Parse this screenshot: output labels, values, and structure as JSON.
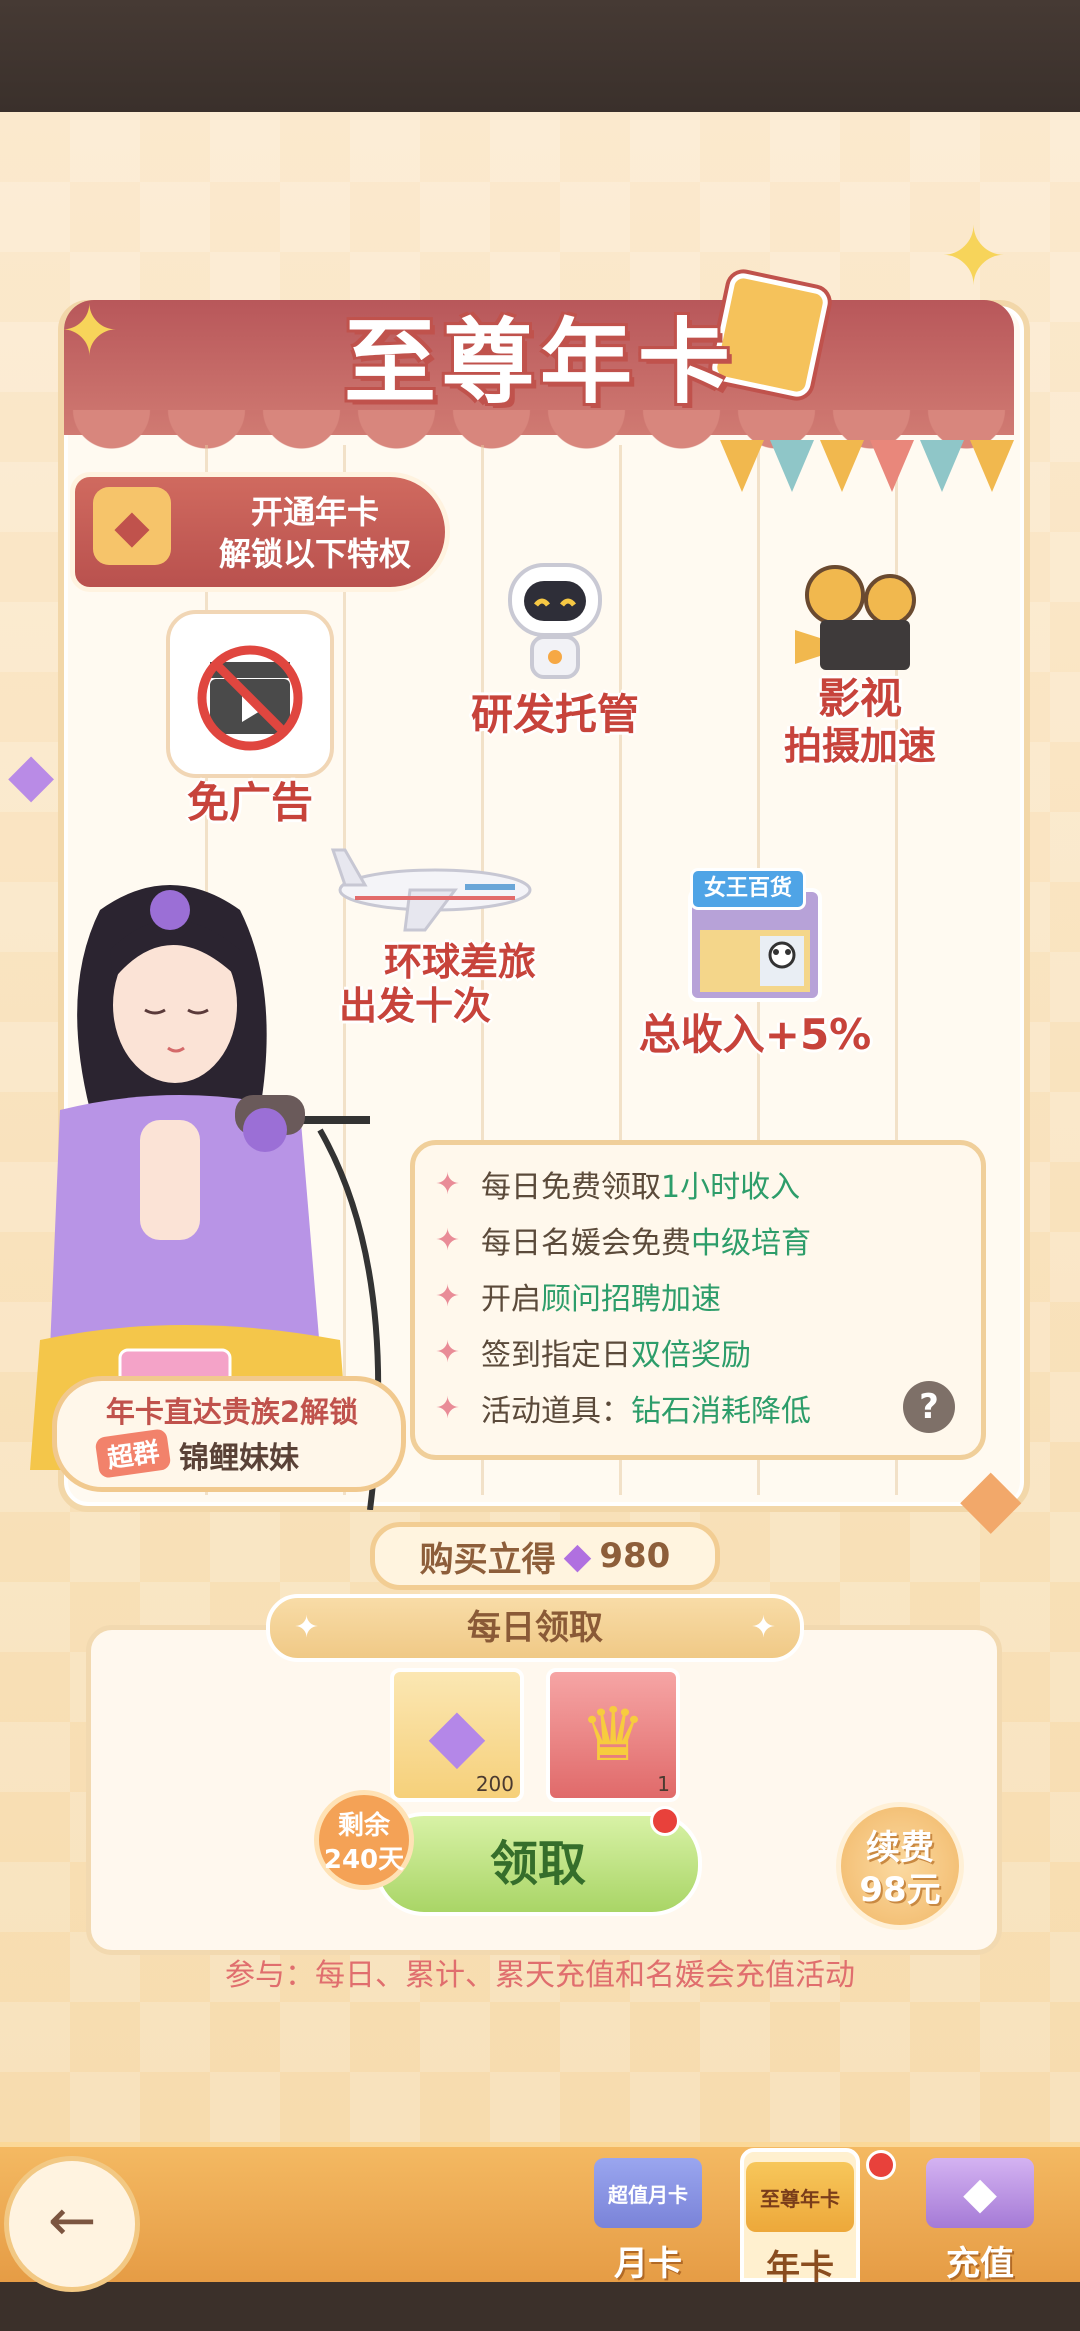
{
  "header": {
    "title": "至尊年卡"
  },
  "ribbon": {
    "line1": "开通年卡",
    "line2": "解锁以下特权"
  },
  "perks": [
    {
      "label": "免广告",
      "icon": "no-ads-clapper-icon"
    },
    {
      "label": "研发托管",
      "icon": "robot-icon"
    },
    {
      "label": "影视",
      "label2": "拍摄加速",
      "icon": "film-projector-icon"
    },
    {
      "label": "环球差旅",
      "label2": "出发十次",
      "icon": "airplane-icon"
    },
    {
      "label": "总收入+5%",
      "icon": "store-icon",
      "store_sign": "女王百货"
    }
  ],
  "benefits": [
    {
      "prefix": "每日免费领取",
      "highlight": "1小时收入"
    },
    {
      "prefix": "每日名媛会免费",
      "highlight": "中级培育"
    },
    {
      "prefix": "开启",
      "highlight": "顾问招聘加速"
    },
    {
      "prefix": "签到指定日",
      "highlight": "双倍奖励"
    },
    {
      "prefix": "活动道具：",
      "highlight": "钻石消耗降低"
    }
  ],
  "help_label": "?",
  "unlock": {
    "line1": "年卡直达贵族2解锁",
    "tag": "超群",
    "name": "锦鲤妹妹"
  },
  "buy": {
    "label": "购买立得",
    "amount": "980"
  },
  "daily": {
    "title": "每日领取",
    "rewards": [
      {
        "icon": "diamond-icon",
        "count": "200"
      },
      {
        "icon": "crown-icon",
        "count": "1"
      }
    ],
    "remain_line1": "剩余",
    "remain_line2": "240天",
    "claim_label": "领取",
    "renew_line1": "续费",
    "renew_line2": "98元"
  },
  "participate": "参与：每日、累计、累天充值和名媛会充值活动",
  "nav": {
    "back_icon": "back-arrow-icon",
    "tabs": [
      {
        "label": "月卡",
        "card_text": "超值月卡",
        "selected": false
      },
      {
        "label": "年卡",
        "card_text": "至尊年卡",
        "selected": true
      },
      {
        "label": "充值",
        "card_text": "",
        "selected": false
      }
    ]
  },
  "colors": {
    "accent_red": "#c0524c",
    "highlight_green": "#2d9d6a",
    "nav_orange": "#e59b44"
  }
}
